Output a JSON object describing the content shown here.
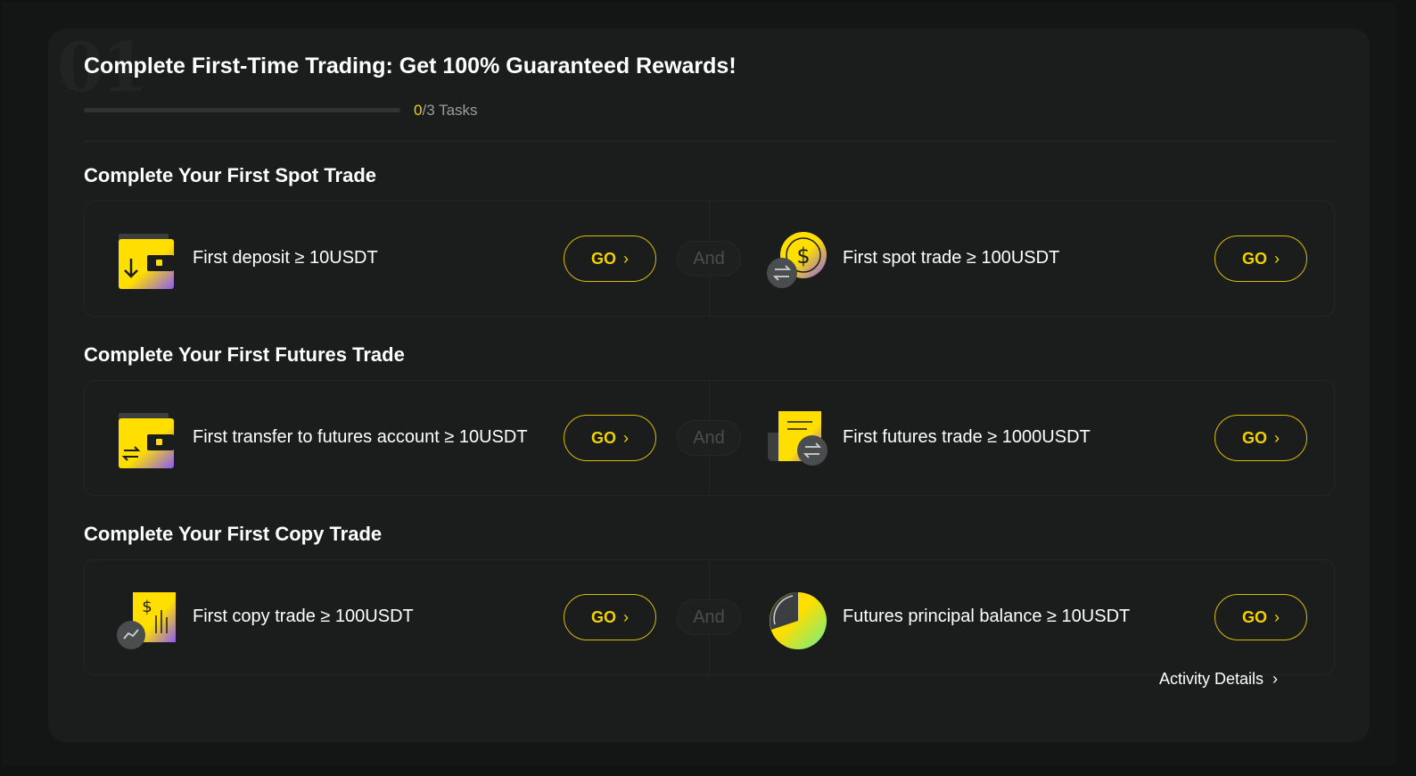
{
  "header": {
    "bg_number": "01",
    "title": "Complete First-Time Trading: Get 100% Guaranteed Rewards!",
    "progress_done": "0",
    "progress_rest": "/3 Tasks",
    "progress_fraction": 0
  },
  "and_label": "And",
  "go_label": "GO",
  "sections": [
    {
      "title": "Complete Your First Spot Trade",
      "left": {
        "icon": "wallet-deposit-icon",
        "label": "First deposit ≥ 10USDT"
      },
      "right": {
        "icon": "coin-exchange-icon",
        "label": "First spot trade ≥ 100USDT"
      }
    },
    {
      "title": "Complete Your First Futures Trade",
      "left": {
        "icon": "wallet-transfer-icon",
        "label": "First transfer to futures account ≥ 10USDT"
      },
      "right": {
        "icon": "futures-document-icon",
        "label": "First futures trade ≥ 1000USDT"
      }
    },
    {
      "title": "Complete Your First Copy Trade",
      "left": {
        "icon": "copy-trade-chart-icon",
        "label": "First copy trade ≥ 100USDT"
      },
      "right": {
        "icon": "pie-chart-balance-icon",
        "label": "Futures principal balance ≥ 10USDT"
      }
    }
  ],
  "footer": {
    "details_label": "Activity Details"
  },
  "colors": {
    "accent": "#f2d200",
    "background": "#1b1d1d",
    "gradient_end": "#8a5cf6"
  }
}
